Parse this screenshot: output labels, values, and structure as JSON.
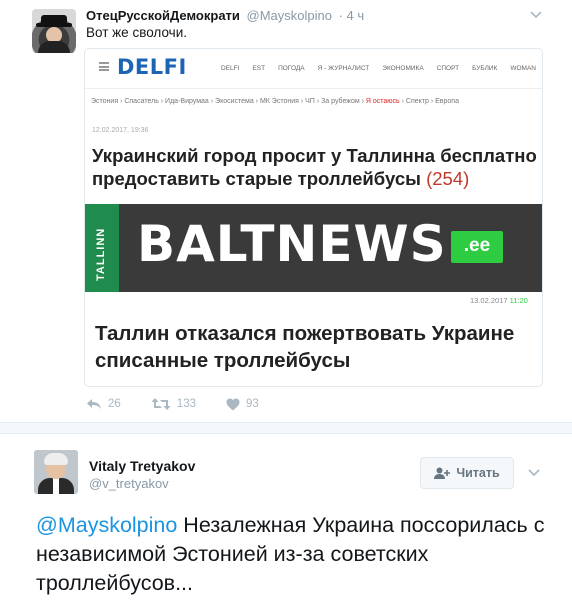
{
  "tweet1": {
    "author_name": "ОтецРусскойДемократи",
    "handle": "@Mayskolpino",
    "time": "· 4 ч",
    "text": "Вот же сволочи.",
    "image": {
      "delfi": {
        "logo": "DELFI",
        "menu": [
          "DELFI",
          "EST",
          "ПОГОДА",
          "Я - ЖУРНАЛИСТ",
          "ЭКОНОМИКА",
          "СПОРТ",
          "БУБЛИК",
          "WOMAN"
        ],
        "breadcrumbs": "Эстония › Спасатель › Ида-Вирумаа › Экосистема › МК Эстония › ЧП › За рубежом ›",
        "breadcrumbs_highlight": "Я остаюсь",
        "breadcrumbs_tail": "› Спектр › Европа",
        "date": "12.02.2017, 19:36",
        "headline": "Украинский город просит у Таллинна бесплатно предоставить старые троллейбусы",
        "comment_count": "(254)"
      },
      "baltnews": {
        "side_label": "TALLINN",
        "logo": "BALTNEWS",
        "logo_suffix": ".ee",
        "date": "13.02.2017",
        "time": "11:20",
        "headline": "Таллин отказался пожертвовать Украине списанные троллейбусы"
      }
    },
    "actions": {
      "replies": "26",
      "retweets": "133",
      "likes": "93"
    }
  },
  "tweet2": {
    "author_name": "Vitaly Tretyakov",
    "handle": "@v_tretyakov",
    "follow_label": "Читать",
    "mention": "@Mayskolpino",
    "text": " Незалежная Украина поссорилась с независимой Эстонией из-за советских троллейбусов..."
  },
  "colors": {
    "accent": "#1b95e0",
    "muted": "#8899a6",
    "delfi_blue": "#1d64b4",
    "baltnews_green": "#2ecc40"
  }
}
